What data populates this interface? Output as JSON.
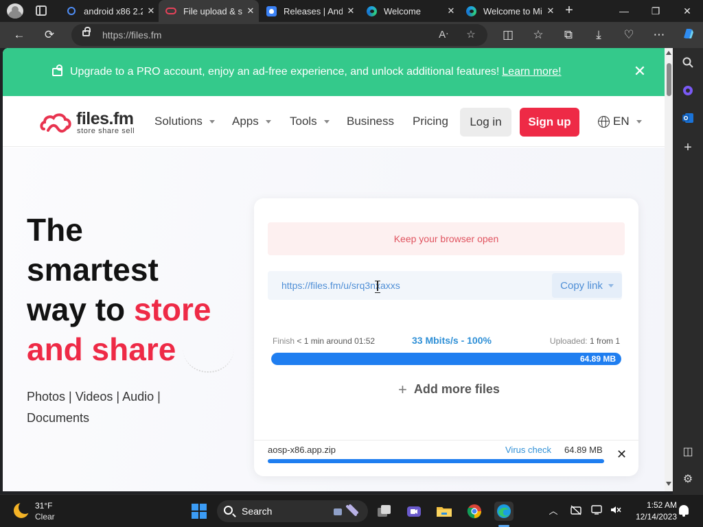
{
  "browser": {
    "tabs": [
      {
        "title": "android x86 2.2",
        "icon": "search-icon",
        "active": false
      },
      {
        "title": "File upload & sh",
        "icon": "files-fm-icon",
        "active": true
      },
      {
        "title": "Releases | Andr",
        "icon": "shield-icon",
        "active": false
      },
      {
        "title": "Welcome",
        "icon": "edge-icon",
        "active": false
      },
      {
        "title": "Welcome to Mi",
        "icon": "edge-icon",
        "active": false
      }
    ],
    "url": "https://files.fm",
    "window_controls": {
      "minimize": "—",
      "maximize": "❐",
      "close": "✕"
    }
  },
  "promo": {
    "text": "Upgrade to a PRO account, enjoy an ad-free experience, and unlock additional features!",
    "link": "Learn more!",
    "bg_color": "#34c98b"
  },
  "site_nav": {
    "logo_name": "files.fm",
    "logo_tagline": "store share sell",
    "items": [
      "Solutions",
      "Apps",
      "Tools",
      "Business",
      "Pricing"
    ],
    "login": "Log in",
    "signup": "Sign up",
    "language": "EN",
    "brand_color": "#ee2a46"
  },
  "hero": {
    "line1": "The",
    "line2": "smartest",
    "line3a": "way to",
    "line3b": "store",
    "line4": "and share",
    "categories": "Photos | Videos | Audio | Documents"
  },
  "upload": {
    "notice": "Keep your browser open",
    "share_url": "https://files.fm/u/srq3nxaxxs",
    "copy_label": "Copy link",
    "finish_label": "Finish",
    "finish_value": "< 1 min around 01:52",
    "speed": "33 Mbits/s - 100%",
    "uploaded_label": "Uploaded:",
    "uploaded_value": "1 from 1",
    "progress_percent": 100,
    "progress_size": "64.89 MB",
    "add_more": "Add more files",
    "file": {
      "name": "aosp-x86.app.zip",
      "virus_check": "Virus check",
      "size": "64.89 MB",
      "progress_percent": 100
    }
  },
  "taskbar": {
    "temperature": "31°F",
    "condition": "Clear",
    "search": "Search",
    "time": "1:52 AM",
    "date": "12/14/2023"
  }
}
